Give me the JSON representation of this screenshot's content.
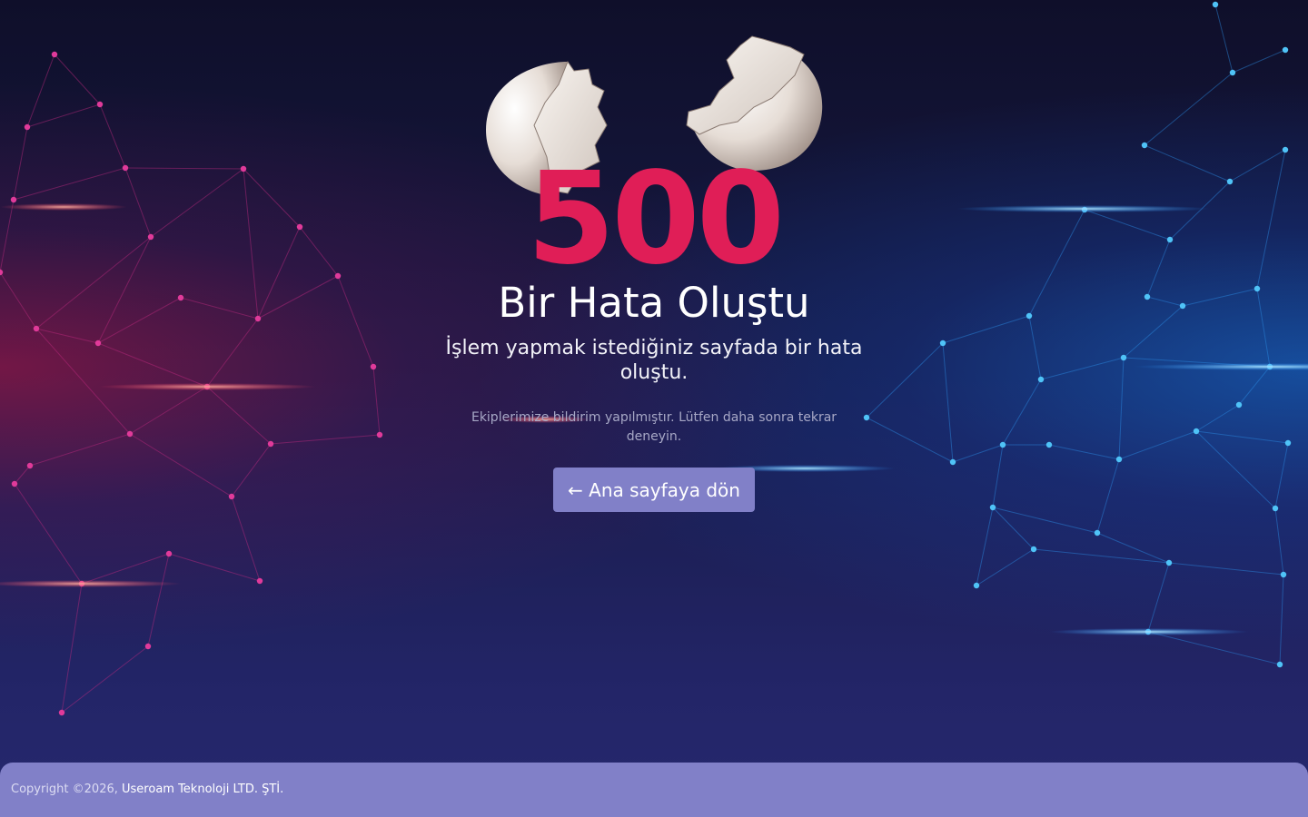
{
  "error": {
    "code": "500",
    "title": "Bir Hata Oluştu",
    "subtitle": "İşlem yapmak istediğiniz sayfada bir hata oluştu.",
    "note": "Ekiplerimize bildirim yapılmıştır. Lütfen daha sonra tekrar deneyin."
  },
  "actions": {
    "home_label": "← Ana sayfaya dön"
  },
  "footer": {
    "copyright": "Copyright ©2026, ",
    "company": "Useroam Teknoloji LTD. ŞTİ."
  },
  "colors": {
    "accent": "#e01e57",
    "button": "#8180c8",
    "background_top": "#0f0f2a",
    "background_bottom": "#26286e",
    "left_glow": "#be1446",
    "right_glow": "#1478e6"
  },
  "illustration": {
    "icon": "broken-egg-shell-icon"
  }
}
